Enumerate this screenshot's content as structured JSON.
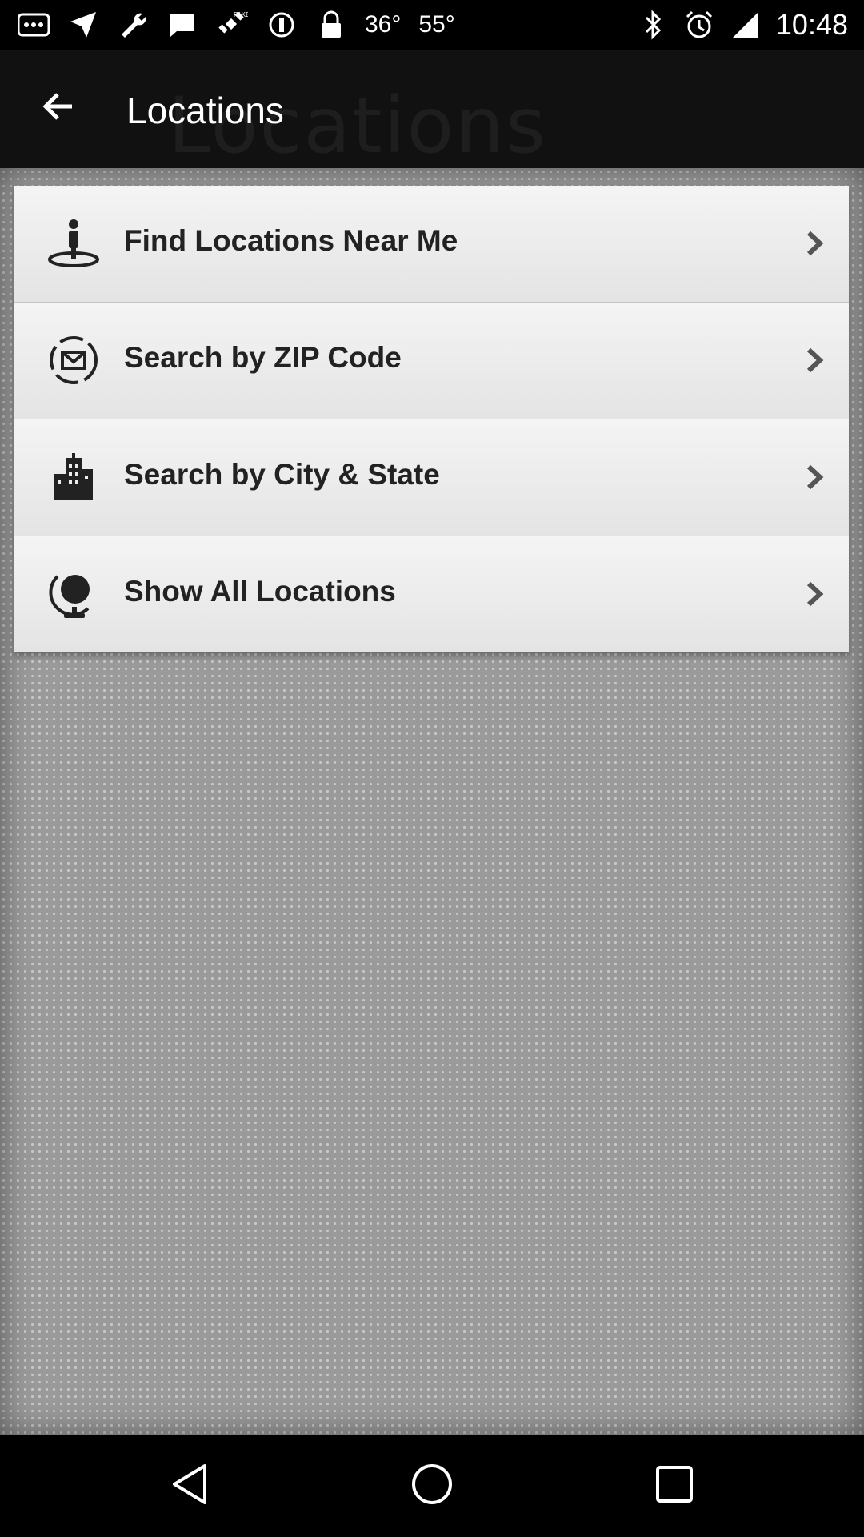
{
  "status_bar": {
    "left_icons": [
      "more-dots-icon",
      "navigation-arrow-icon",
      "wrench-icon",
      "message-icon",
      "fake-gps-satellite-icon",
      "do-not-disturb-icon",
      "lock-icon"
    ],
    "temp1": "36°",
    "temp2": "55°",
    "right_icons": [
      "bluetooth-icon",
      "alarm-clock-icon",
      "signal-icon"
    ],
    "time": "10:48"
  },
  "app_bar": {
    "title": "Locations",
    "watermark": "Locations"
  },
  "menu": {
    "items": [
      {
        "label": "Find Locations Near Me",
        "icon": "person-pin-icon"
      },
      {
        "label": "Search by ZIP Code",
        "icon": "mail-envelope-icon"
      },
      {
        "label": "Search by City & State",
        "icon": "city-building-icon"
      },
      {
        "label": "Show All Locations",
        "icon": "globe-icon"
      }
    ]
  },
  "nav_bar": {
    "buttons": [
      "back-triangle-icon",
      "home-circle-icon",
      "recents-square-icon"
    ]
  }
}
